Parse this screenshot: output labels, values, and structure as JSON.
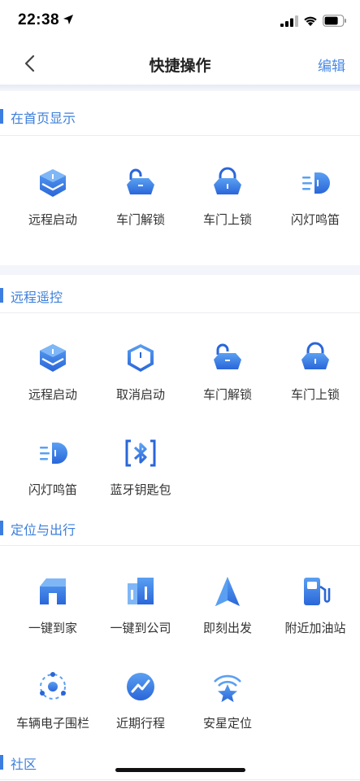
{
  "status": {
    "time": "22:38"
  },
  "nav": {
    "title": "快捷操作",
    "edit_label": "编辑"
  },
  "sections": [
    {
      "title": "在首页显示",
      "tiles": [
        {
          "label": "远程启动",
          "icon": "remote-start-icon"
        },
        {
          "label": "车门解锁",
          "icon": "door-unlock-icon"
        },
        {
          "label": "车门上锁",
          "icon": "door-lock-icon"
        },
        {
          "label": "闪灯鸣笛",
          "icon": "flash-horn-icon"
        }
      ]
    },
    {
      "title": "远程遥控",
      "tiles": [
        {
          "label": "远程启动",
          "icon": "remote-start-icon"
        },
        {
          "label": "取消启动",
          "icon": "cancel-start-icon"
        },
        {
          "label": "车门解锁",
          "icon": "door-unlock-icon"
        },
        {
          "label": "车门上锁",
          "icon": "door-lock-icon"
        },
        {
          "label": "闪灯鸣笛",
          "icon": "flash-horn-icon"
        },
        {
          "label": "蓝牙钥匙包",
          "icon": "bluetooth-key-icon"
        }
      ]
    },
    {
      "title": "定位与出行",
      "tiles": [
        {
          "label": "一键到家",
          "icon": "home-icon"
        },
        {
          "label": "一键到公司",
          "icon": "office-icon"
        },
        {
          "label": "即刻出发",
          "icon": "navigate-arrow-icon"
        },
        {
          "label": "附近加油站",
          "icon": "gas-station-icon"
        },
        {
          "label": "车辆电子围栏",
          "icon": "geofence-icon"
        },
        {
          "label": "近期行程",
          "icon": "recent-trips-icon"
        },
        {
          "label": "安星定位",
          "icon": "star-location-icon"
        }
      ]
    },
    {
      "title": "社区",
      "tiles": []
    }
  ],
  "colors": {
    "accent": "#3c7de0",
    "icon_light": "#5aa0f2",
    "icon_dark": "#2a66d9"
  }
}
